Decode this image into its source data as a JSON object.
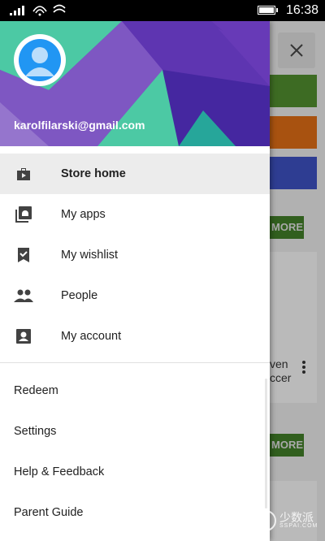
{
  "status_bar": {
    "time": "16:38"
  },
  "drawer": {
    "email": "karolfilarski@gmail.com",
    "nav_items": [
      {
        "label": "Store home",
        "icon": "store-icon",
        "active": true
      },
      {
        "label": "My apps",
        "icon": "my-apps-icon",
        "active": false
      },
      {
        "label": "My wishlist",
        "icon": "wishlist-icon",
        "active": false
      },
      {
        "label": "People",
        "icon": "people-icon",
        "active": false
      },
      {
        "label": "My account",
        "icon": "account-icon",
        "active": false
      }
    ],
    "menu_items": [
      "Redeem",
      "Settings",
      "Help & Feedback",
      "Parent Guide"
    ]
  },
  "background": {
    "more_label": "MORE",
    "card_text": [
      "ven",
      "ccer"
    ]
  },
  "watermark": {
    "cn": "少数派",
    "en": "SSPAI.COM"
  },
  "colors": {
    "header_purple": "#673ab7",
    "header_teal": "#4cc9a4",
    "accent_green": "#3f7a27",
    "tile_green": "#4f8a2e",
    "tile_orange": "#d86a15",
    "tile_blue": "#3b4fbb"
  }
}
